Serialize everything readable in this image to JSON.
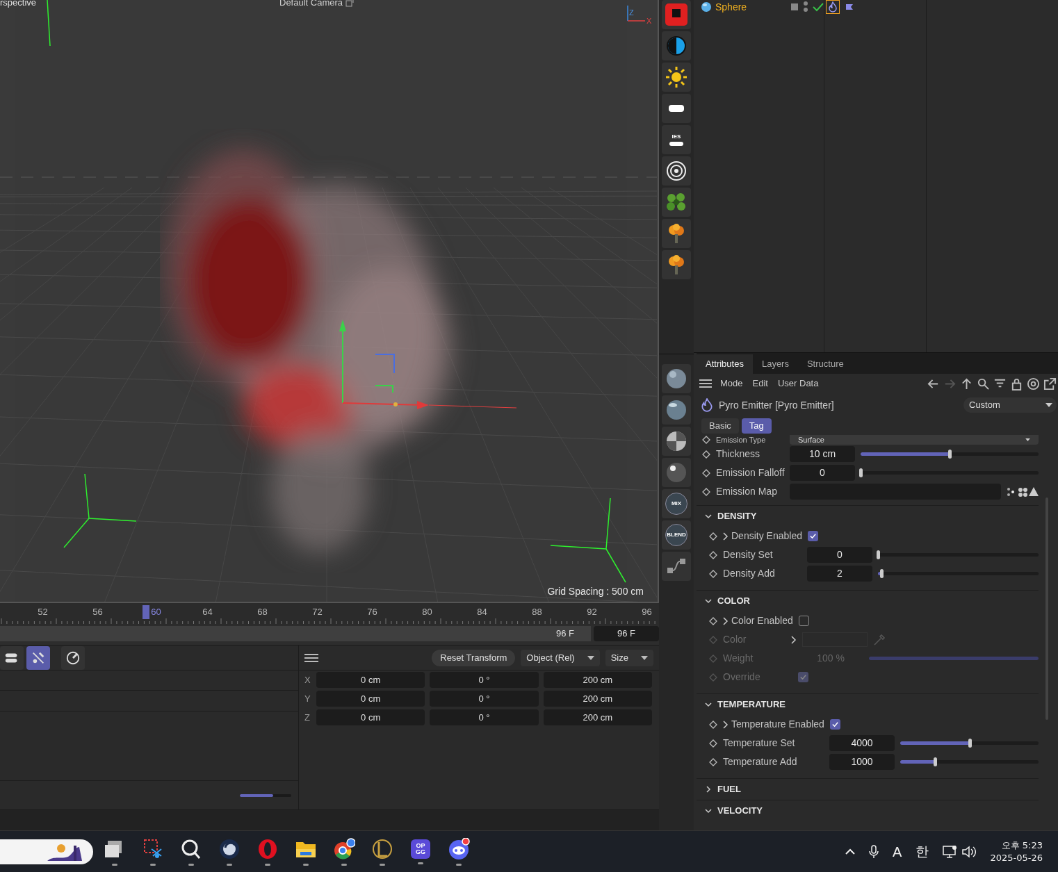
{
  "viewport": {
    "camera_label": "rspective",
    "title": "Default Camera",
    "grid_spacing": "Grid Spacing : 500 cm",
    "gizmo_axes": [
      "Z",
      "X"
    ]
  },
  "object_manager": {
    "objects": [
      {
        "name": "Sphere",
        "tags": [
          {
            "kind": "pyro",
            "selected": true
          },
          {
            "kind": "flag",
            "selected": false
          }
        ]
      }
    ]
  },
  "palette": {
    "top": [
      {
        "kind": "record"
      },
      {
        "kind": "half"
      },
      {
        "kind": "sun"
      },
      {
        "kind": "area"
      },
      {
        "kind": "ies",
        "label": "IES"
      },
      {
        "kind": "rings"
      },
      {
        "kind": "blobs"
      },
      {
        "kind": "tree"
      },
      {
        "kind": "tree"
      }
    ],
    "bottom": [
      {
        "kind": "sphere"
      },
      {
        "kind": "glass"
      },
      {
        "kind": "checker"
      },
      {
        "kind": "chrome"
      },
      {
        "kind": "badge",
        "label": "MIX"
      },
      {
        "kind": "badge",
        "label": "BLEND"
      },
      {
        "kind": "nodes"
      }
    ]
  },
  "attributes": {
    "tabs": [
      {
        "label": "Attributes",
        "selected": true
      },
      {
        "label": "Layers",
        "selected": false
      },
      {
        "label": "Structure",
        "selected": false
      }
    ],
    "menu": [
      "Mode",
      "Edit",
      "User Data"
    ],
    "object_title": "Pyro Emitter [Pyro Emitter]",
    "preset": "Custom",
    "subtabs": [
      {
        "label": "Basic",
        "selected": false
      },
      {
        "label": "Tag",
        "selected": true
      }
    ],
    "top_params": [
      {
        "kind": "dropdown",
        "label": "Emission Type",
        "value": "Surface"
      },
      {
        "kind": "slider",
        "label": "Thickness",
        "value": "10 cm",
        "level": 0.5
      },
      {
        "kind": "slider",
        "label": "Emission Falloff",
        "value": "0",
        "level": 0
      },
      {
        "kind": "map",
        "label": "Emission Map"
      }
    ],
    "sections": [
      {
        "title": "DENSITY",
        "expanded": true,
        "params": [
          {
            "kind": "checkbox",
            "label": "Density Enabled",
            "checked": true
          },
          {
            "kind": "slider",
            "label": "Density Set",
            "value": "0",
            "level": 0
          },
          {
            "kind": "slider",
            "label": "Density Add",
            "value": "2",
            "level": 0.02
          }
        ]
      },
      {
        "title": "COLOR",
        "expanded": true,
        "params": [
          {
            "kind": "checkbox",
            "label": "Color Enabled",
            "checked": false
          },
          {
            "kind": "color",
            "label": "Color",
            "disabled": true
          },
          {
            "kind": "slider",
            "label": "Weight",
            "value": "100 %",
            "level": 1,
            "disabled": true
          },
          {
            "kind": "toggle",
            "label": "Override",
            "checked": true,
            "disabled": true
          }
        ]
      },
      {
        "title": "TEMPERATURE",
        "expanded": true,
        "params": [
          {
            "kind": "checkbox",
            "label": "Temperature Enabled",
            "checked": true
          },
          {
            "kind": "slider",
            "label": "Temperature Set",
            "value": "4000",
            "level": 0.5
          },
          {
            "kind": "slider",
            "label": "Temperature Add",
            "value": "1000",
            "level": 0.25
          }
        ]
      },
      {
        "title": "FUEL",
        "expanded": false
      },
      {
        "title": "VELOCITY",
        "expanded": true
      }
    ]
  },
  "timeline": {
    "frames": [
      {
        "label": "52",
        "selected": false
      },
      {
        "label": "56",
        "selected": false
      },
      {
        "label": "60",
        "selected": true
      },
      {
        "label": "64",
        "selected": false
      },
      {
        "label": "68",
        "selected": false
      },
      {
        "label": "72",
        "selected": false
      },
      {
        "label": "76",
        "selected": false
      },
      {
        "label": "80",
        "selected": false
      },
      {
        "label": "84",
        "selected": false
      },
      {
        "label": "88",
        "selected": false
      },
      {
        "label": "92",
        "selected": false
      },
      {
        "label": "96",
        "selected": false
      }
    ],
    "end_frame": "96 F",
    "max_frame": "96 F"
  },
  "layers_panel": {
    "tools": [
      {
        "kind": "toggle",
        "selected": false
      },
      {
        "kind": "snap",
        "selected": true
      },
      {
        "kind": "gauge",
        "selected": false
      }
    ],
    "zoom": {
      "level": 0.65
    }
  },
  "coordinates": {
    "reset": "Reset Transform",
    "mode": "Object (Rel)",
    "size_mode": "Size",
    "rows": [
      {
        "axis": "X",
        "position": "0 cm",
        "rotation": "0 °",
        "size": "200 cm"
      },
      {
        "axis": "Y",
        "position": "0 cm",
        "rotation": "0 °",
        "size": "200 cm"
      },
      {
        "axis": "Z",
        "position": "0 cm",
        "rotation": "0 °",
        "size": "200 cm"
      }
    ]
  },
  "taskbar": {
    "apps": [
      {
        "kind": "taskview"
      },
      {
        "kind": "snip"
      },
      {
        "kind": "search-app"
      },
      {
        "kind": "c4d"
      },
      {
        "kind": "opera"
      },
      {
        "kind": "folder"
      },
      {
        "kind": "chrome"
      },
      {
        "kind": "league"
      },
      {
        "kind": "opgg",
        "label": "OP GG"
      },
      {
        "kind": "discord"
      }
    ],
    "tray": {
      "ime_mode": "A",
      "ime_lang": "한",
      "time": "오후 5:23",
      "date": "2025-05-26"
    }
  }
}
